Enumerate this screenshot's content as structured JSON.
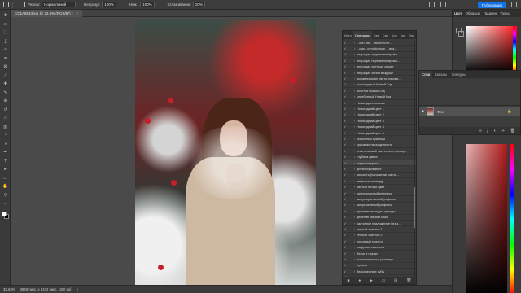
{
  "options_bar": {
    "mode_label": "Режим:",
    "mode_value": "Нормальный",
    "opacity_label": "Непрозр.:",
    "opacity_value": "100%",
    "flow_label": "Наж.:",
    "flow_value": "100%",
    "smoothing_label": "Сглаживание:",
    "smoothing_value": "10%",
    "publish_label": "Публикация"
  },
  "document": {
    "tab_title": "CC1A8843.jpg @ 32,6% (RGB/8*) *",
    "close_glyph": "×"
  },
  "actions_panel": {
    "tabs": [
      "Исто",
      "Операции",
      "Све",
      "Сво",
      "Кор",
      "Кис",
      "Зна"
    ],
    "active_tab": 1,
    "check_glyph": "✓",
    "arrow_glyph": "›",
    "items": [
      "...соб инс. ...вательнет...",
      "...смо...ссто фотогр. ...вка...",
      "операция недоэкспонирова...",
      "операция переэкспонирова...",
      "операция светлые сюжет",
      "операция синий воздушн",
      "выравнивание свето-тонова...",
      "шоколадный Новый Год",
      "золотой Новый Год",
      "серебряный Новый Год",
      "Новогоднее сияние",
      "Новогодний цвет 1",
      "Новогодний цвет 2",
      "Новогодний цвет 3",
      "Новогодний цвет 4",
      "Новогодний цвет 5",
      "сказочный красный",
      "красивая насыщенность",
      "пластический частотного ороаэр...",
      "глубина цвета",
      "микроконтраст",
      "фильтрирование",
      "мягкость (наложение карта...",
      "закатаем-гармоду",
      "чистый белый цвет",
      "минус красный рефлекс",
      "минус оранжевый рефлекс",
      "минус зеленый рефлекс",
      "деление текстуры одежды",
      "деление мягким кожи",
      "частотное разложение без з...",
      "теплый скинтон 1",
      "теплый скинтон 2",
      "холодный скинтон",
      "сведение скинтона",
      "блеск в глазах",
      "выразительные ресницы",
      "румяна",
      "белоснежные зубы",
      "осветление волос"
    ],
    "footer_icons": [
      "stop-icon",
      "record-icon",
      "play-icon",
      "folder-icon",
      "new-action-icon",
      "trash-icon"
    ]
  },
  "color_panel": {
    "tabs": [
      "Цвет",
      "Образцы",
      "Градиен",
      "Узоры"
    ],
    "active_tab": 0,
    "foreground": "#ffffff",
    "background": "#000000",
    "accent_red": "#ff1a1a"
  },
  "layers_panel": {
    "tabs": [
      "Слои",
      "Каналы",
      "Контуры"
    ],
    "active_tab": 0,
    "layer_name": "Фон",
    "eye_glyph": "●",
    "lock_glyph": "🔒"
  },
  "status_bar": {
    "zoom": "32,63%",
    "doc_info": "3840 пикс. x 5472 пикс. (300 ppi)",
    "arrow": "›"
  },
  "toolbar": {
    "icons": [
      "move-icon",
      "artboard-icon",
      "marquee-icon",
      "lasso-icon",
      "quick-select-icon",
      "crop-icon",
      "frame-icon",
      "eyedropper-icon",
      "healing-brush-icon",
      "brush-icon",
      "clone-stamp-icon",
      "history-brush-icon",
      "eraser-icon",
      "gradient-icon",
      "blur-icon",
      "dodge-icon",
      "pen-icon",
      "type-icon",
      "path-select-icon",
      "rectangle-icon",
      "hand-icon",
      "zoom-icon",
      "more-tools-icon"
    ]
  }
}
